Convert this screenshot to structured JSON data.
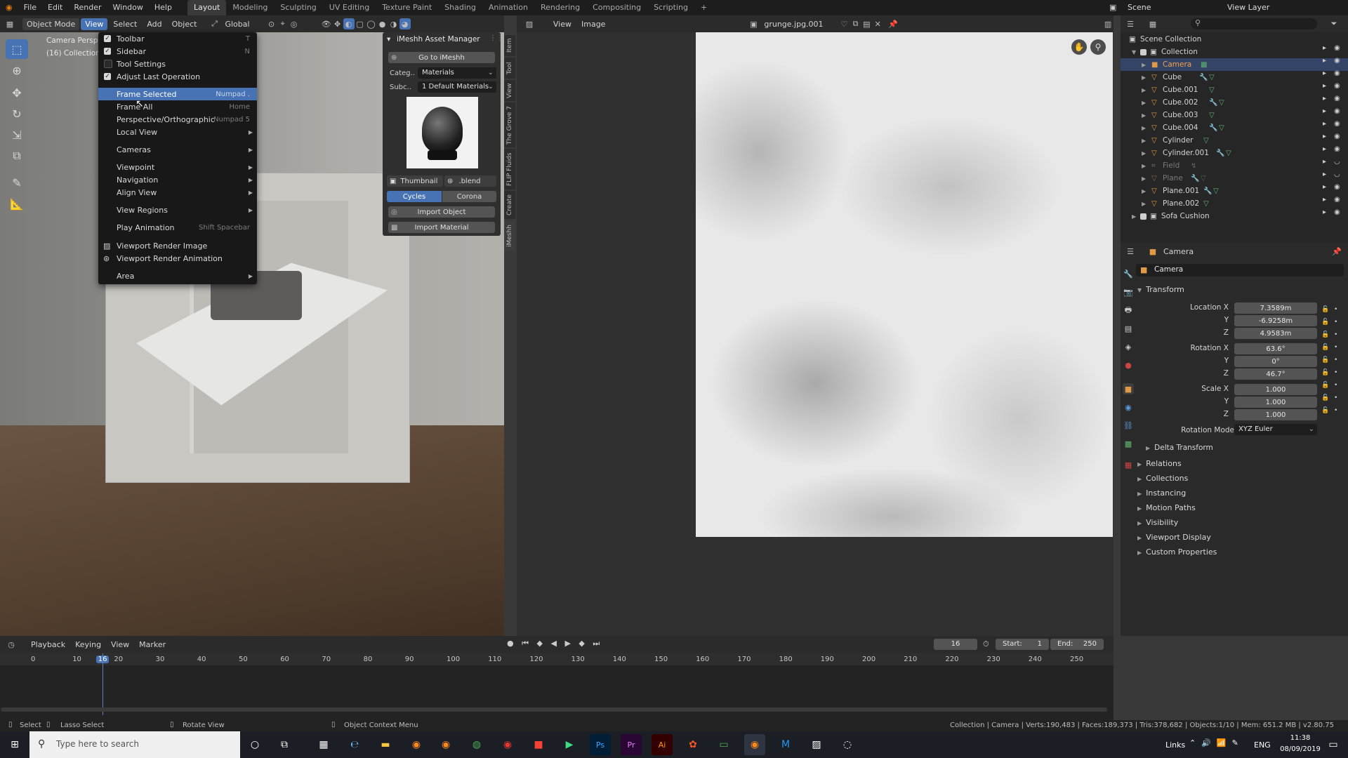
{
  "app": {
    "menus": [
      "File",
      "Edit",
      "Render",
      "Window",
      "Help"
    ],
    "workspaces": [
      "Layout",
      "Modeling",
      "Sculpting",
      "UV Editing",
      "Texture Paint",
      "Shading",
      "Animation",
      "Rendering",
      "Compositing",
      "Scripting"
    ],
    "add_tab": "+",
    "scene": "Scene",
    "view_layer": "View Layer"
  },
  "viewport_header": {
    "mode": "Object Mode",
    "menus": [
      "View",
      "Select",
      "Add",
      "Object"
    ],
    "orientation": "Global",
    "overlay_lines": [
      "Camera Perspe",
      "(16) Collection"
    ]
  },
  "view_menu": {
    "items": [
      {
        "label": "Toolbar",
        "shortcut": "T",
        "check": true
      },
      {
        "label": "Sidebar",
        "shortcut": "N",
        "check": true
      },
      {
        "label": "Tool Settings",
        "shortcut": "",
        "check": false
      },
      {
        "label": "Adjust Last Operation",
        "shortcut": "",
        "check": true
      },
      {
        "label": "Frame Selected",
        "shortcut": "Numpad .",
        "highlight": true
      },
      {
        "label": "Frame All",
        "shortcut": "Home"
      },
      {
        "label": "Perspective/Orthographic",
        "shortcut": "Numpad 5"
      },
      {
        "label": "Local View",
        "submenu": true
      },
      {
        "label": "Cameras",
        "submenu": true
      },
      {
        "label": "Viewpoint",
        "submenu": true
      },
      {
        "label": "Navigation",
        "submenu": true
      },
      {
        "label": "Align View",
        "submenu": true
      },
      {
        "label": "View Regions",
        "submenu": true
      },
      {
        "label": "Play Animation",
        "shortcut": "Shift Spacebar"
      },
      {
        "label": "Viewport Render Image",
        "icon": "image-icon"
      },
      {
        "label": "Viewport Render Animation",
        "icon": "render-animation-icon"
      },
      {
        "label": "Area",
        "submenu": true
      }
    ]
  },
  "asset_manager": {
    "title": "iMeshh Asset Manager",
    "goto_label": "Go to iMeshh",
    "category_label": "Categ..",
    "category_value": "Materials",
    "subcat_label": "Subc..",
    "subcat_value": "1 Default Materials",
    "thumbnail_label": "Thumbnail",
    "blend_label": ".blend",
    "render_engines": [
      "Cycles",
      "Corona"
    ],
    "active_engine": "Cycles",
    "import_object": "Import Object",
    "import_material": "Import Material"
  },
  "side_tabs": [
    "Item",
    "Tool",
    "View",
    "The Grove 7",
    "FLIP Fluids",
    "Create",
    "iMeshh"
  ],
  "image_editor": {
    "menus": [
      "View",
      "Image"
    ],
    "image_name": "grunge.jpg.001"
  },
  "outliner": {
    "root": "Scene Collection",
    "collection": "Collection",
    "objects": [
      {
        "name": "Camera",
        "selected": true,
        "hidden": false
      },
      {
        "name": "Cube",
        "hidden": false
      },
      {
        "name": "Cube.001",
        "hidden": false
      },
      {
        "name": "Cube.002",
        "hidden": false
      },
      {
        "name": "Cube.003",
        "hidden": false
      },
      {
        "name": "Cube.004",
        "hidden": false
      },
      {
        "name": "Cylinder",
        "hidden": false
      },
      {
        "name": "Cylinder.001",
        "hidden": false
      },
      {
        "name": "Field",
        "hidden": true
      },
      {
        "name": "Plane",
        "hidden": true
      },
      {
        "name": "Plane.001",
        "hidden": false
      },
      {
        "name": "Plane.002",
        "hidden": false
      }
    ],
    "extra_collection": "Sofa Cushion"
  },
  "properties": {
    "object_name": "Camera",
    "data_name": "Camera",
    "transform_title": "Transform",
    "rows": [
      {
        "label": "Location X",
        "value": "7.3589m"
      },
      {
        "label": "Y",
        "value": "-6.9258m"
      },
      {
        "label": "Z",
        "value": "4.9583m"
      },
      {
        "label": "Rotation X",
        "value": "63.6°"
      },
      {
        "label": "Y",
        "value": "0°"
      },
      {
        "label": "Z",
        "value": "46.7°"
      },
      {
        "label": "Scale X",
        "value": "1.000"
      },
      {
        "label": "Y",
        "value": "1.000"
      },
      {
        "label": "Z",
        "value": "1.000"
      }
    ],
    "rotation_mode_label": "Rotation Mode",
    "rotation_mode_value": "XYZ Euler",
    "delta_transform": "Delta Transform",
    "sections": [
      "Relations",
      "Collections",
      "Instancing",
      "Motion Paths",
      "Visibility",
      "Viewport Display",
      "Custom Properties"
    ]
  },
  "timeline": {
    "menus": [
      "Playback",
      "Keying",
      "View",
      "Marker"
    ],
    "current_frame": "16",
    "start_label": "Start:",
    "start": "1",
    "end_label": "End:",
    "end": "250",
    "ticks": [
      "0",
      "10",
      "16",
      "20",
      "30",
      "40",
      "50",
      "60",
      "70",
      "80",
      "90",
      "100",
      "110",
      "120",
      "130",
      "140",
      "150",
      "160",
      "170",
      "180",
      "190",
      "200",
      "210",
      "220",
      "230",
      "240",
      "250"
    ]
  },
  "statusbar": {
    "left": [
      "Select",
      "Lasso Select",
      "Rotate View",
      "Object Context Menu"
    ],
    "right": "Collection | Camera | Verts:190,483 | Faces:189,373 | Tris:378,682 | Objects:1/10 | Mem: 651.2 MB | v2.80.75"
  },
  "taskbar": {
    "search_placeholder": "Type here to search",
    "links": "Links",
    "lang": "ENG",
    "time": "11:38",
    "date": "08/09/2019"
  }
}
